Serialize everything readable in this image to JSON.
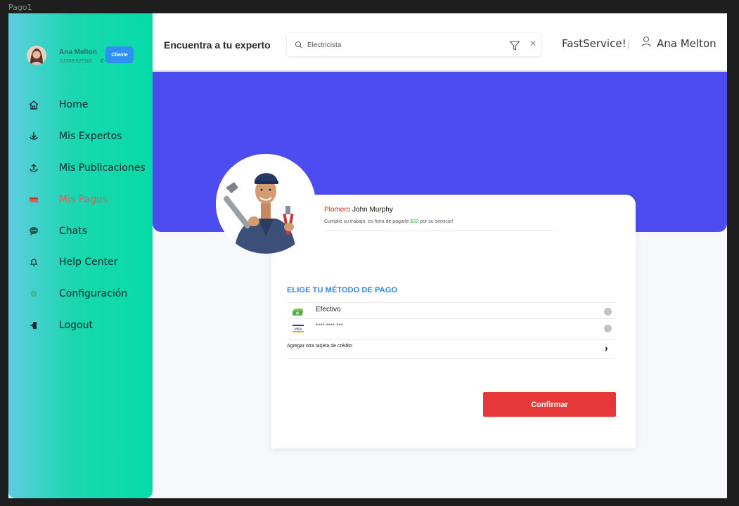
{
  "canvas": {
    "page_label": "Pago1"
  },
  "profile": {
    "name": "Ana Melton",
    "phone": "01303-527300",
    "badge": "Cliente"
  },
  "nav": {
    "items": [
      {
        "label": "Home",
        "icon": "home-icon"
      },
      {
        "label": "Mis Expertos",
        "icon": "download-anchor-icon"
      },
      {
        "label": "Mis Publicaciones",
        "icon": "anchor-icon"
      },
      {
        "label": "Mis Pagos",
        "icon": "card-icon",
        "active": true
      },
      {
        "label": "Chats",
        "icon": "chat-icon"
      },
      {
        "label": "Help Center",
        "icon": "bell-icon"
      },
      {
        "label": "Configuración",
        "icon": "gear-icon"
      },
      {
        "label": "Logout",
        "icon": "logout-icon"
      }
    ]
  },
  "header": {
    "title": "Encuentra a tu experto",
    "search_value": "Electricista",
    "brand": "FastService!",
    "user": "Ana Melton"
  },
  "worker": {
    "profession": "Plomero",
    "name": "John Murphy",
    "message_before": "Cumplió su trabajo, es hora de pagarle",
    "amount": "$32",
    "message_after": "por su servicio!"
  },
  "payment": {
    "title": "ELIGE TU MÉTODO DE PAGO",
    "methods": [
      {
        "label": "Efectivo",
        "icon": "cash-icon"
      },
      {
        "label": "**** **** ***",
        "icon": "visa-icon"
      }
    ],
    "add_card": "Agregar otra tarjeta de crédito",
    "confirm": "Confirmar"
  },
  "colors": {
    "sidebar_start": "#5fcde0",
    "sidebar_end": "#06dba8",
    "banner": "#4c4cf0",
    "accent_red": "#e63838",
    "title_blue": "#2e86e8",
    "badge_blue": "#2f8ff0",
    "amount_green": "#2fb845",
    "active_nav": "#e45b55"
  }
}
